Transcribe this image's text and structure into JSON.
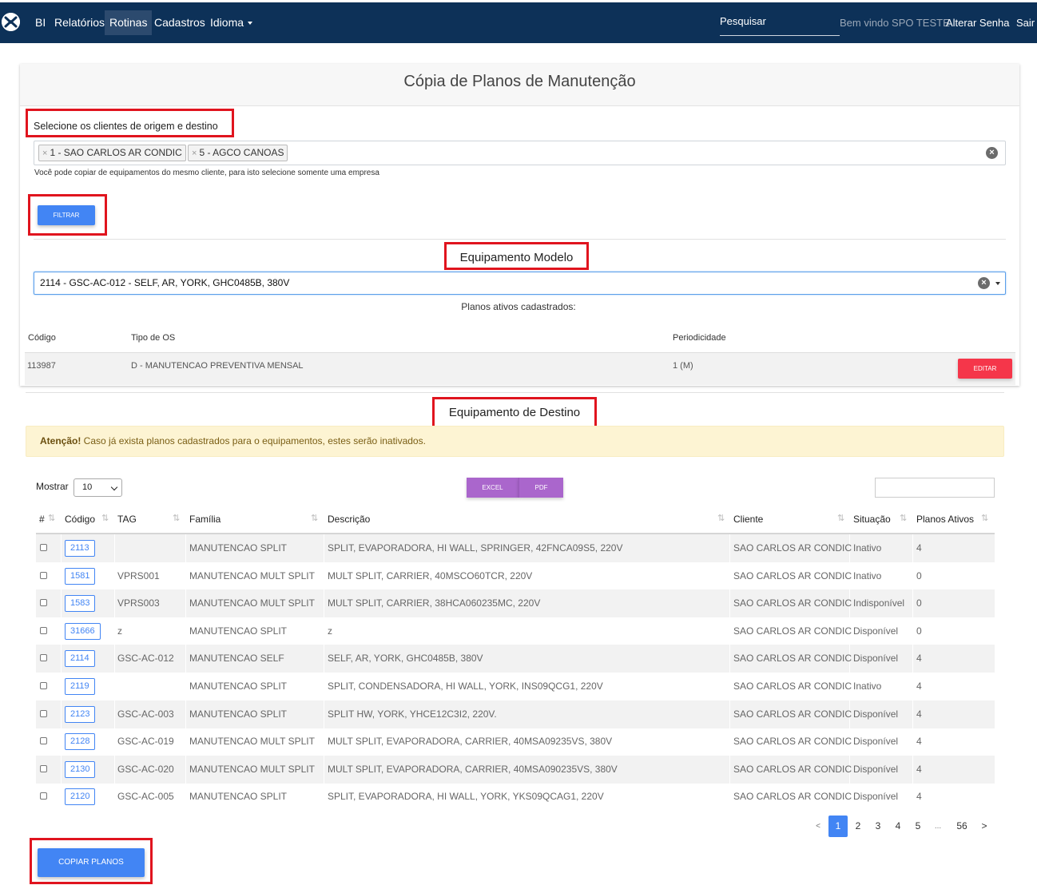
{
  "nav": {
    "bi": "BI",
    "relatorios": "Relatórios",
    "rotinas": "Rotinas",
    "cadastros": "Cadastros",
    "idioma": "Idioma",
    "search_placeholder": "Pesquisar",
    "welcome": "Bem vindo SPO TESTE",
    "change_password": "Alterar Senha",
    "logout": "Sair"
  },
  "page": {
    "title": "Cópia de Planos de Manutenção"
  },
  "clients": {
    "label": "Selecione os clientes de origem e destino",
    "chips": [
      "1 - SAO CARLOS AR CONDIC",
      "5 - AGCO CANOAS"
    ],
    "help": "Você pode copiar de equipamentos do mesmo cliente, para isto selecione somente uma empresa",
    "filter_button": "FILTRAR"
  },
  "model": {
    "title": "Equipamento Modelo",
    "selected": "2114 - GSC-AC-012 - SELF, AR, YORK, GHC0485B, 380V",
    "plans_label": "Planos ativos cadastrados:",
    "columns": [
      "Código",
      "Tipo de OS",
      "Periodicidade"
    ],
    "plans": [
      {
        "codigo": "113987",
        "tipo": "D - MANUTENCAO PREVENTIVA MENSAL",
        "periodicidade": "1 (M)",
        "action": "EDITAR"
      }
    ]
  },
  "destination": {
    "title": "Equipamento de Destino",
    "alert_strong": "Atenção!",
    "alert_text": " Caso já exista planos cadastrados para o equipamentos, estes serão inativados.",
    "show_label": "Mostrar",
    "page_length": "10",
    "excel_button": "EXCEL",
    "pdf_button": "PDF",
    "columns": [
      "#",
      "Código",
      "TAG",
      "Família",
      "Descrição",
      "Cliente",
      "Situação",
      "Planos Ativos"
    ],
    "rows": [
      {
        "codigo": "2113",
        "tag": "",
        "familia": "MANUTENCAO SPLIT",
        "descricao": "SPLIT, EVAPORADORA, HI WALL, SPRINGER, 42FNCA09S5, 220V",
        "cliente": "SAO CARLOS AR CONDIC",
        "situacao": "Inativo",
        "planos": "4"
      },
      {
        "codigo": "1581",
        "tag": "VPRS001",
        "familia": "MANUTENCAO MULT SPLIT",
        "descricao": "MULT SPLIT, CARRIER, 40MSCO60TCR, 220V",
        "cliente": "SAO CARLOS AR CONDIC",
        "situacao": "Inativo",
        "planos": "0"
      },
      {
        "codigo": "1583",
        "tag": "VPRS003",
        "familia": "MANUTENCAO MULT SPLIT",
        "descricao": "MULT SPLIT, CARRIER, 38HCA060235MC, 220V",
        "cliente": "SAO CARLOS AR CONDIC",
        "situacao": "Indisponível",
        "planos": "0"
      },
      {
        "codigo": "31666",
        "tag": "z",
        "familia": "MANUTENCAO SPLIT",
        "descricao": "z",
        "cliente": "SAO CARLOS AR CONDIC",
        "situacao": "Disponível",
        "planos": "0"
      },
      {
        "codigo": "2114",
        "tag": "GSC-AC-012",
        "familia": "MANUTENCAO SELF",
        "descricao": "SELF, AR, YORK, GHC0485B, 380V",
        "cliente": "SAO CARLOS AR CONDIC",
        "situacao": "Disponível",
        "planos": "4"
      },
      {
        "codigo": "2119",
        "tag": "",
        "familia": "MANUTENCAO SPLIT",
        "descricao": "SPLIT, CONDENSADORA, HI WALL, YORK, INS09QCG1, 220V",
        "cliente": "SAO CARLOS AR CONDIC",
        "situacao": "Inativo",
        "planos": "4"
      },
      {
        "codigo": "2123",
        "tag": "GSC-AC-003",
        "familia": "MANUTENCAO SPLIT",
        "descricao": "SPLIT HW, YORK, YHCE12C3I2, 220V.",
        "cliente": "SAO CARLOS AR CONDIC",
        "situacao": "Disponível",
        "planos": "4"
      },
      {
        "codigo": "2128",
        "tag": "GSC-AC-019",
        "familia": "MANUTENCAO MULT SPLIT",
        "descricao": "MULT SPLIT, EVAPORADORA, CARRIER, 40MSA09235VS, 380V",
        "cliente": "SAO CARLOS AR CONDIC",
        "situacao": "Disponível",
        "planos": "4"
      },
      {
        "codigo": "2130",
        "tag": "GSC-AC-020",
        "familia": "MANUTENCAO MULT SPLIT",
        "descricao": "MULT SPLIT, EVAPORADORA, CARRIER, 40MSA090235VS, 380V",
        "cliente": "SAO CARLOS AR CONDIC",
        "situacao": "Disponível",
        "planos": "4"
      },
      {
        "codigo": "2120",
        "tag": "GSC-AC-005",
        "familia": "MANUTENCAO SPLIT",
        "descricao": "SPLIT, EVAPORADORA, HI WALL, YORK, YKS09QCAG1, 220V",
        "cliente": "SAO CARLOS AR CONDIC",
        "situacao": "Disponível",
        "planos": "4"
      }
    ],
    "pagination": {
      "prev": "<",
      "pages": [
        "1",
        "2",
        "3",
        "4",
        "5"
      ],
      "ellipsis": "...",
      "last": "56",
      "next": ">",
      "current": "1"
    },
    "copy_button": "COPIAR PLANOS"
  },
  "colors": {
    "navbar": "#0d3158",
    "primary": "#4285f4",
    "danger": "#f5364a",
    "purple": "#aa66cc",
    "highlight_box": "#e0141e",
    "alert_bg": "#fdf4d3"
  }
}
